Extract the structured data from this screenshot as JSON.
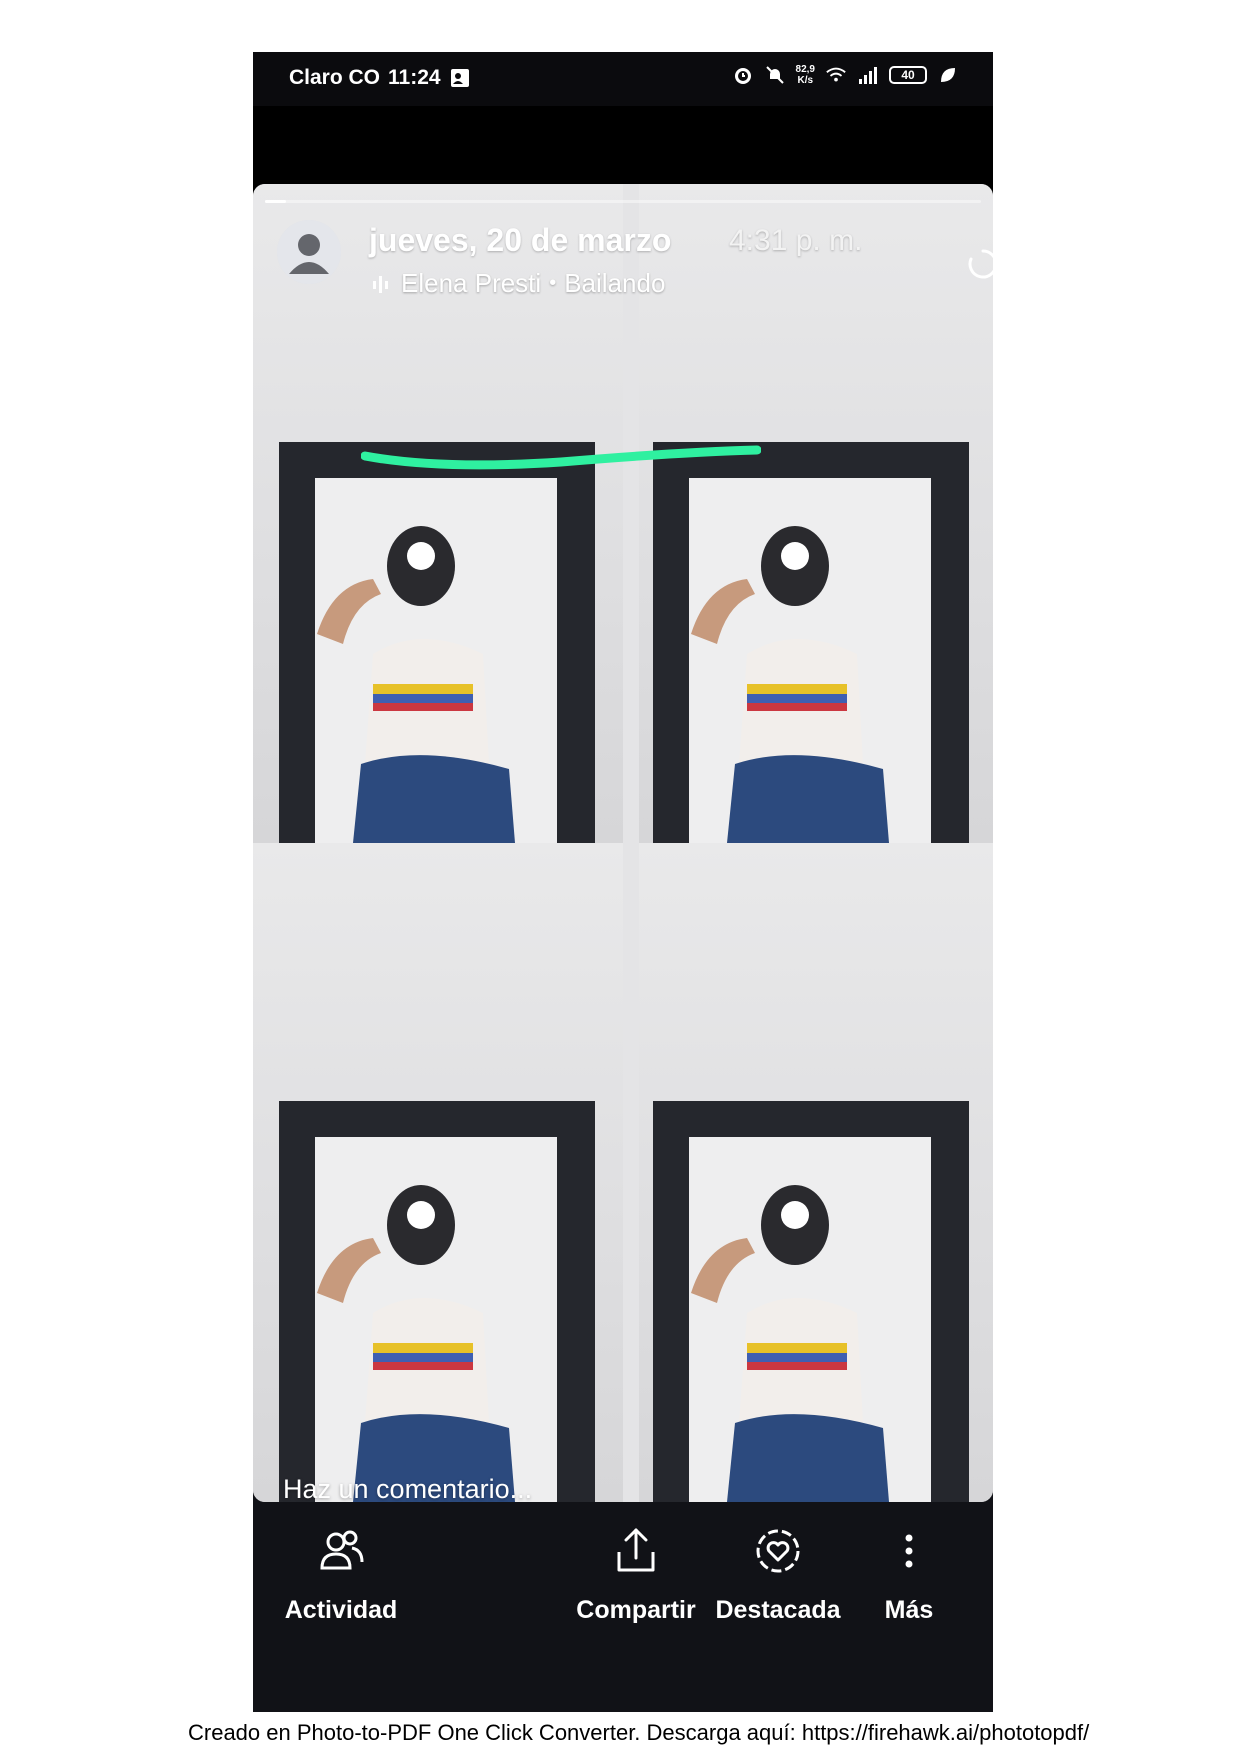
{
  "status_bar": {
    "carrier": "Claro CO",
    "time": "11:24",
    "speed_value": "82,9",
    "speed_unit": "K/s",
    "battery": "40"
  },
  "story": {
    "progress": 0.03,
    "date": "jueves, 20 de marzo",
    "time": "4:31 p. m.",
    "artist": "Elena Presti",
    "song": "Bailando",
    "separator": "•",
    "comment_placeholder": "Haz un comentario...",
    "highlight_color": "#2ff0a0"
  },
  "actions": [
    {
      "label": "Actividad",
      "icon": "people-icon"
    },
    {
      "label": "Compartir",
      "icon": "share-icon"
    },
    {
      "label": "Destacada",
      "icon": "heart-circle-icon"
    },
    {
      "label": "Más",
      "icon": "more-vertical-icon"
    }
  ],
  "footer": {
    "credit": "Creado en Photo-to-PDF One Click Converter. Descarga aquí: https://firehawk.ai/phototopdf/"
  }
}
